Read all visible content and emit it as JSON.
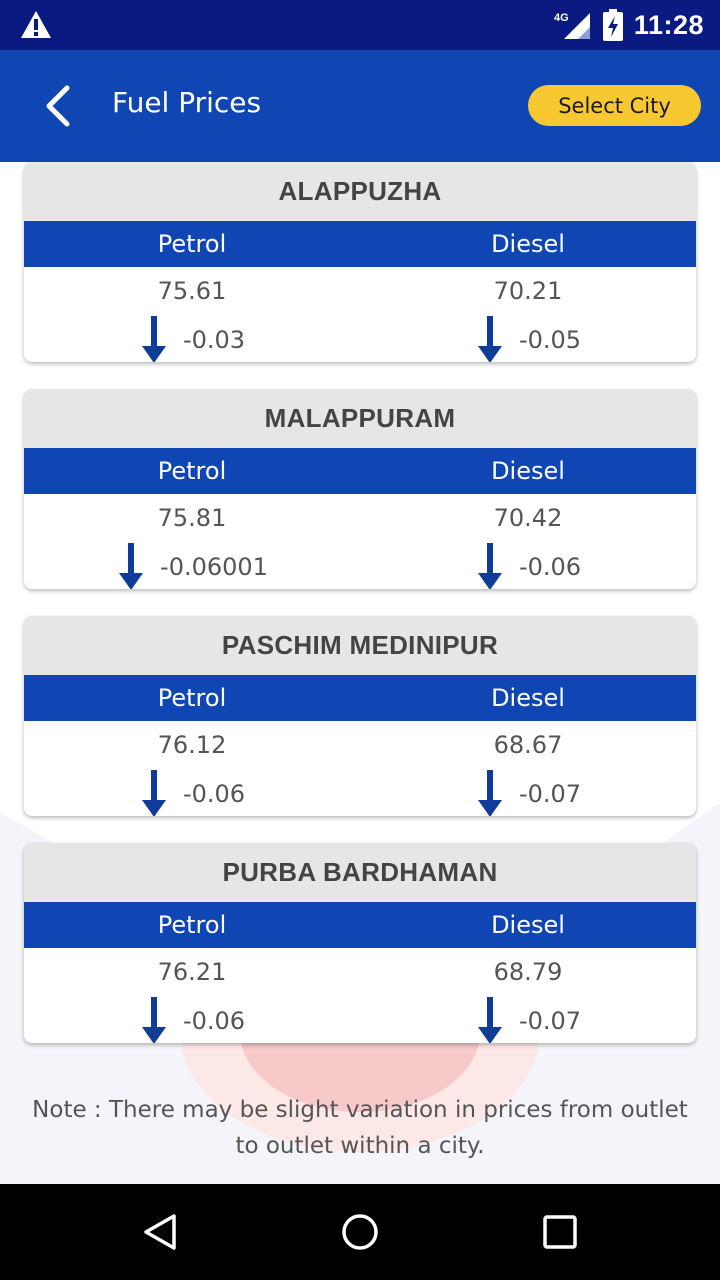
{
  "status": {
    "network": "4G",
    "time": "11:28"
  },
  "header": {
    "title": "Fuel Prices",
    "select_city_label": "Select City"
  },
  "cards": [
    {
      "city": "ALAPPUZHA",
      "petrol_label": "Petrol",
      "diesel_label": "Diesel",
      "petrol_price": "75.61",
      "diesel_price": "70.21",
      "petrol_change": "-0.03",
      "diesel_change": "-0.05"
    },
    {
      "city": "MALAPPURAM",
      "petrol_label": "Petrol",
      "diesel_label": "Diesel",
      "petrol_price": "75.81",
      "diesel_price": "70.42",
      "petrol_change": "-0.06001",
      "diesel_change": "-0.06"
    },
    {
      "city": "PASCHIM MEDINIPUR",
      "petrol_label": "Petrol",
      "diesel_label": "Diesel",
      "petrol_price": "76.12",
      "diesel_price": "68.67",
      "petrol_change": "-0.06",
      "diesel_change": "-0.07"
    },
    {
      "city": "PURBA BARDHAMAN",
      "petrol_label": "Petrol",
      "diesel_label": "Diesel",
      "petrol_price": "76.21",
      "diesel_price": "68.79",
      "petrol_change": "-0.06",
      "diesel_change": "-0.07"
    }
  ],
  "note": "Note : There may be slight variation in prices from outlet to outlet within a city.",
  "colors": {
    "primary": "#0f46b4",
    "status_bar": "#0a1a80",
    "accent": "#f8c832",
    "arrow": "#0f3c9a"
  },
  "icons": {
    "back": "chevron-left-icon",
    "change": "down-arrow-icon",
    "warning": "warning-icon"
  }
}
